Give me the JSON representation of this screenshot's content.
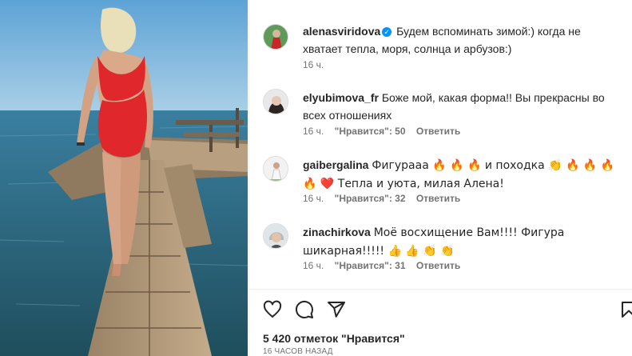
{
  "caption": {
    "username": "alenasviridova",
    "verified": true,
    "text": "Будем вспоминать зимой:) когда не хватает тепла, моря, солнца и арбузов:)",
    "time": "16 ч."
  },
  "comments": [
    {
      "username": "elyubimova_fr",
      "text": "Боже мой, какая форма!! Вы прекрасны во всех отношениях",
      "time": "16 ч.",
      "likes": "\"Нравится\": 50",
      "reply": "Ответить"
    },
    {
      "username": "gaibergalina",
      "text": "Фигурааа 🔥 🔥 🔥 и походка 👏 🔥 🔥 🔥 🔥 ❤️ Тепла и уюта, милая Алена!",
      "time": "16 ч.",
      "likes": "\"Нравится\": 32",
      "reply": "Ответить"
    },
    {
      "username": "zinachirkova",
      "text": "Моё восхищение Вам!!!! Фигура шикарная!!!!! 👍 👍 👏 👏",
      "time": "16 ч.",
      "likes": "\"Нравится\": 31",
      "reply": "Ответить"
    }
  ],
  "actions": {
    "like_icon": "heart-icon",
    "comment_icon": "comment-icon",
    "share_icon": "share-icon",
    "save_icon": "bookmark-icon"
  },
  "likes_text": "5 420 отметок \"Нравится\"",
  "time_ago": "16 ЧАСОВ НАЗАД",
  "colors": {
    "verified": "#0095f6",
    "meta_gray": "#737373",
    "sea": "#2f6f86",
    "sky": "#79b4dc",
    "swimsuit": "#e0272b"
  }
}
